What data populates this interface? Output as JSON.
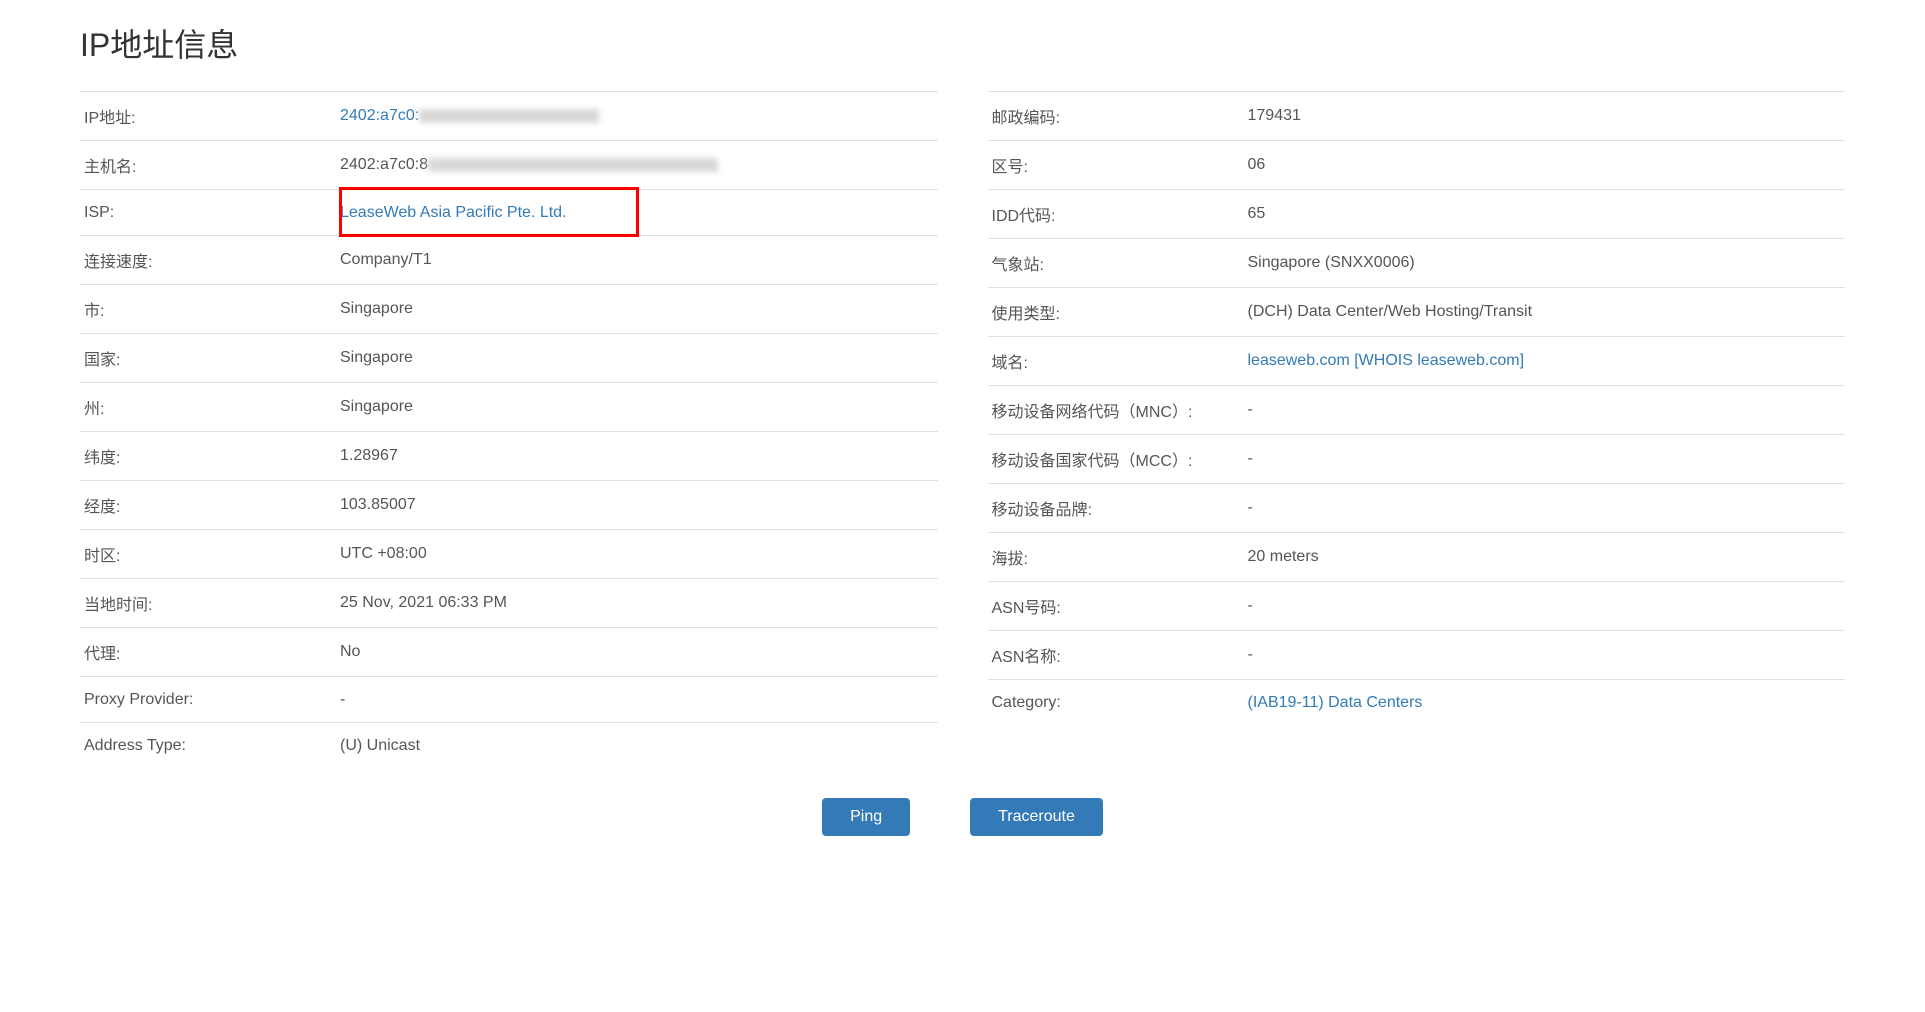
{
  "page_title": "IP地址信息",
  "left": [
    {
      "label": "IP地址:",
      "prefix": "2402:a7c0:",
      "value": "",
      "type": "ip"
    },
    {
      "label": "主机名:",
      "prefix": "2402:a7c0:8",
      "value": "",
      "type": "host"
    },
    {
      "label": "ISP:",
      "value": "LeaseWeb Asia Pacific Pte. Ltd.",
      "type": "link",
      "highlight": true
    },
    {
      "label": "连接速度:",
      "value": "Company/T1",
      "type": "text"
    },
    {
      "label": "市:",
      "value": "Singapore",
      "type": "text"
    },
    {
      "label": "国家:",
      "value": "Singapore",
      "type": "text"
    },
    {
      "label": "州:",
      "value": "Singapore",
      "type": "text"
    },
    {
      "label": "纬度:",
      "value": "1.28967",
      "type": "text"
    },
    {
      "label": "经度:",
      "value": "103.85007",
      "type": "text"
    },
    {
      "label": "时区:",
      "value": "UTC +08:00",
      "type": "text"
    },
    {
      "label": "当地时间:",
      "value": "25 Nov, 2021 06:33 PM",
      "type": "text"
    },
    {
      "label": "代理:",
      "value": "No",
      "type": "text"
    },
    {
      "label": "Proxy Provider:",
      "value": "-",
      "type": "text"
    },
    {
      "label": "Address Type:",
      "value": "(U) Unicast",
      "type": "text"
    }
  ],
  "right": [
    {
      "label": "邮政编码:",
      "value": "179431",
      "type": "text"
    },
    {
      "label": "区号:",
      "value": "06",
      "type": "text"
    },
    {
      "label": "IDD代码:",
      "value": "65",
      "type": "text"
    },
    {
      "label": "气象站:",
      "value": "Singapore (SNXX0006)",
      "type": "text"
    },
    {
      "label": "使用类型:",
      "value": "(DCH) Data Center/Web Hosting/Transit",
      "type": "text"
    },
    {
      "label": "域名:",
      "value": "leaseweb.com [WHOIS leaseweb.com]",
      "type": "link"
    },
    {
      "label": "移动设备网络代码（MNC）:",
      "value": "-",
      "type": "text"
    },
    {
      "label": "移动设备国家代码（MCC）:",
      "value": "-",
      "type": "text"
    },
    {
      "label": "移动设备品牌:",
      "value": "-",
      "type": "text"
    },
    {
      "label": "海拔:",
      "value": "20 meters",
      "type": "text"
    },
    {
      "label": "ASN号码:",
      "value": "-",
      "type": "text"
    },
    {
      "label": "ASN名称:",
      "value": "-",
      "type": "text"
    },
    {
      "label": "Category:",
      "value": "(IAB19-11) Data Centers",
      "type": "link"
    }
  ],
  "buttons": {
    "ping": "Ping",
    "traceroute": "Traceroute"
  }
}
